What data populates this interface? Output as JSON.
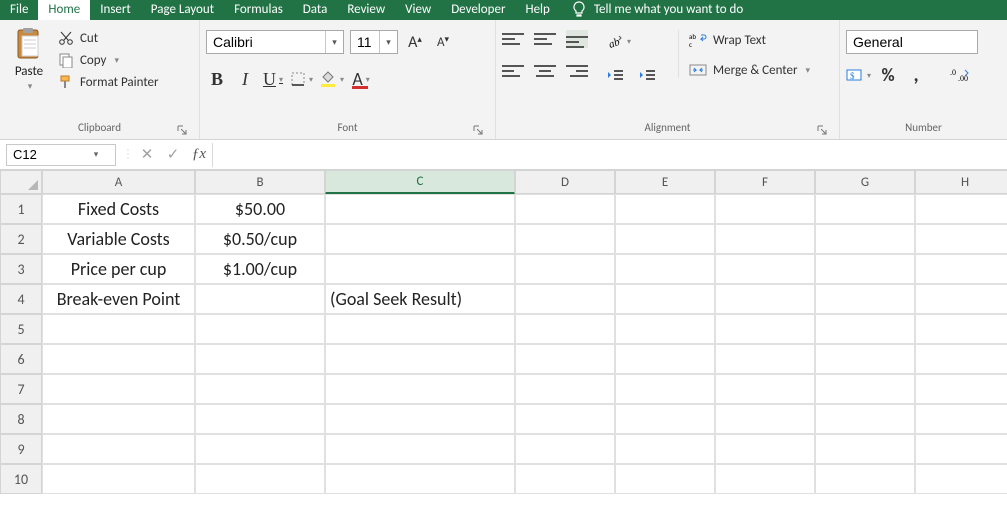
{
  "tabs": {
    "file": "File",
    "home": "Home",
    "insert": "Insert",
    "pagelayout": "Page Layout",
    "formulas": "Formulas",
    "data": "Data",
    "review": "Review",
    "view": "View",
    "developer": "Developer",
    "help": "Help",
    "tellme": "Tell me what you want to do"
  },
  "clipboard": {
    "paste": "Paste",
    "cut": "Cut",
    "copy": "Copy",
    "format_painter": "Format Painter",
    "group": "Clipboard"
  },
  "font": {
    "name_value": "Calibri",
    "size_value": "11",
    "group": "Font"
  },
  "alignment": {
    "wrap": "Wrap Text",
    "merge": "Merge & Center",
    "group": "Alignment"
  },
  "number": {
    "format_value": "General",
    "group": "Number"
  },
  "formula_bar": {
    "namebox": "C12",
    "formula": ""
  },
  "columns": [
    "A",
    "B",
    "C",
    "D",
    "E",
    "F",
    "G",
    "H"
  ],
  "rows": [
    "1",
    "2",
    "3",
    "4",
    "5",
    "6",
    "7",
    "8",
    "9",
    "10"
  ],
  "cells": {
    "A1": "Fixed Costs",
    "B1": "$50.00",
    "A2": "Variable Costs",
    "B2": "$0.50/cup",
    "A3": "Price per cup",
    "B3": "$1.00/cup",
    "A4": "Break-even Point",
    "C4": "(Goal Seek Result)"
  },
  "active": {
    "col": "C",
    "row": "12"
  },
  "glyphs": {
    "percent": "%",
    "comma": ","
  }
}
